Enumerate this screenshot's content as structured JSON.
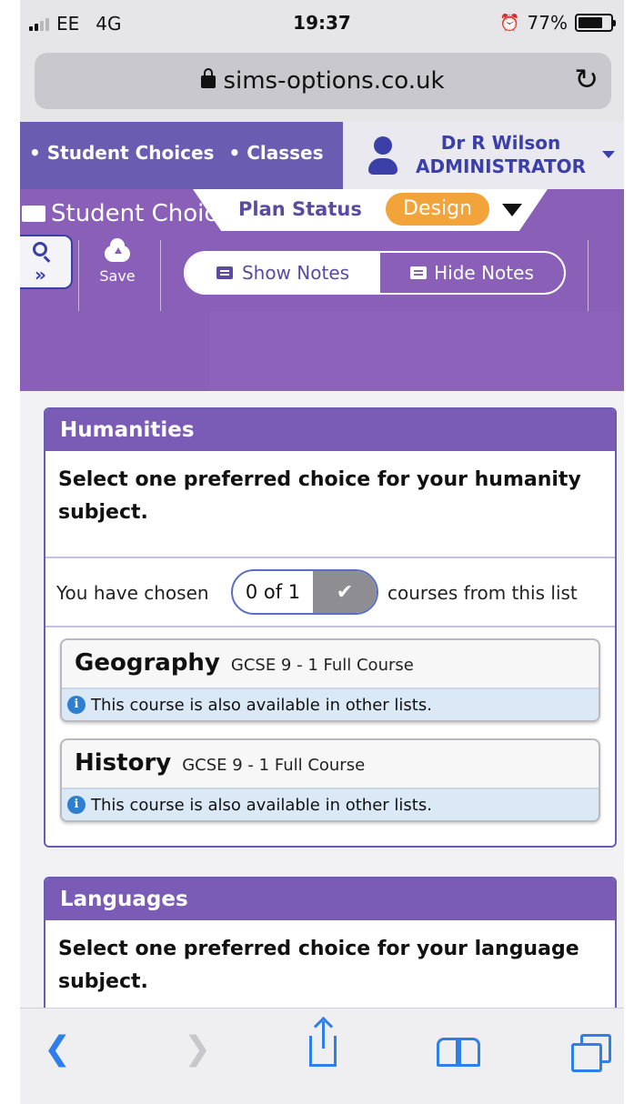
{
  "status_bar": {
    "carrier": "EE",
    "network": "4G",
    "time": "19:37",
    "battery": "77%",
    "battery_level": 0.77
  },
  "browser": {
    "url": "sims-options.co.uk"
  },
  "nav": {
    "links": [
      "Student Choices",
      "Classes"
    ]
  },
  "user": {
    "name": "Dr R Wilson",
    "role": "ADMINISTRATOR"
  },
  "page": {
    "title": "Student Choices",
    "plan_status_label": "Plan Status",
    "plan_status_value": "Design"
  },
  "toolbar": {
    "save_label": "Save",
    "show_notes": "Show Notes",
    "hide_notes": "Hide Notes"
  },
  "panels": [
    {
      "title": "Humanities",
      "description": "Select one preferred choice for your humanity subject.",
      "chosen_prefix": "You have chosen",
      "chosen_count": "0 of 1",
      "chosen_suffix": "courses from this list",
      "courses": [
        {
          "name": "Geography",
          "type": "GCSE 9 - 1 Full Course",
          "note": "This course is also available in other lists."
        },
        {
          "name": "History",
          "type": "GCSE 9 - 1 Full Course",
          "note": "This course is also available in other lists."
        }
      ]
    },
    {
      "title": "Languages",
      "description": "Select one preferred choice for your language subject."
    }
  ],
  "colors": {
    "header_purple": "#6a5db1",
    "sub_purple": "#8a5fb8",
    "status_orange": "#f2a43a",
    "ios_blue": "#2f7fea"
  }
}
